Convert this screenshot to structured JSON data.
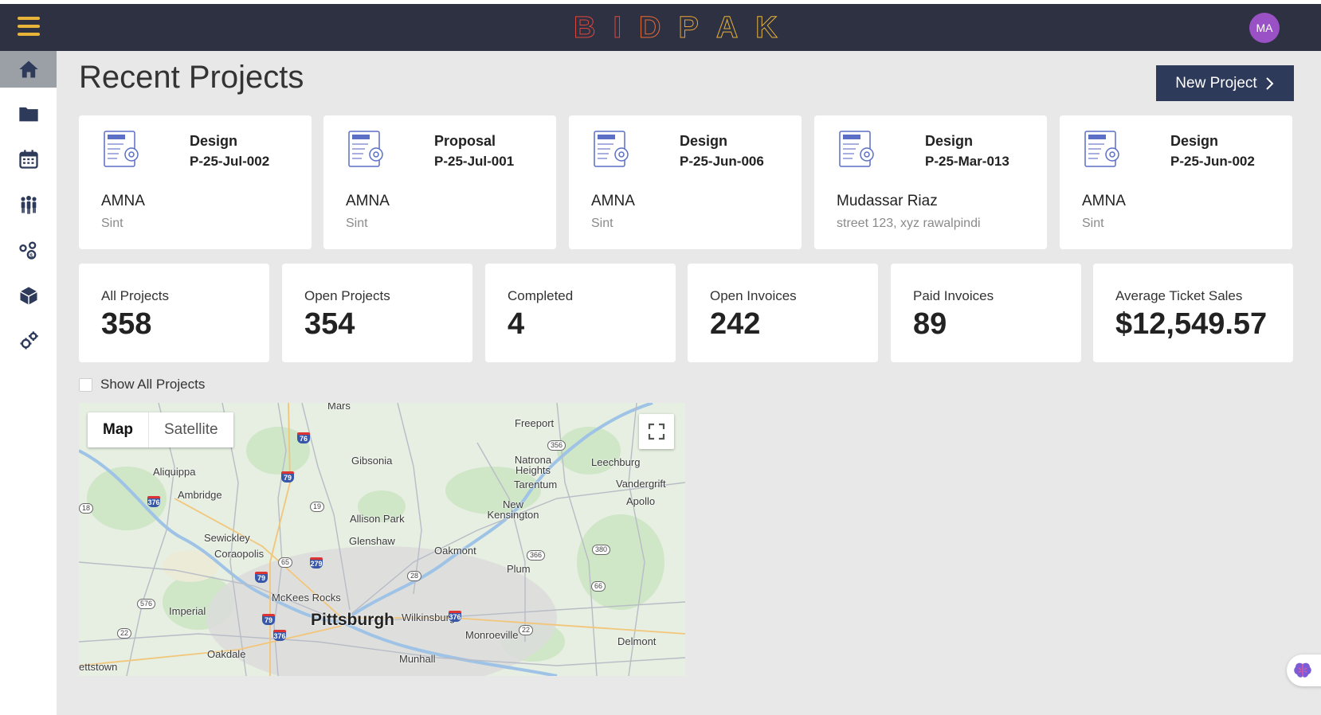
{
  "header": {
    "brand_letters": [
      "B",
      "I",
      "D",
      "P",
      "A",
      "K"
    ],
    "brand_colors": [
      "#e0473c",
      "#e0473c",
      "#e86a35",
      "#e8a437",
      "#e8b339",
      "#e8b339"
    ],
    "accent_color": "#e8b339",
    "avatar_initials": "MA",
    "avatar_color": "#9b51c6",
    "menu_icon": "hamburger-icon"
  },
  "sidebar": {
    "items": [
      {
        "name": "home",
        "icon": "home-icon",
        "active": true
      },
      {
        "name": "projects",
        "icon": "folder-icon",
        "active": false
      },
      {
        "name": "calendar",
        "icon": "calendar-icon",
        "active": false
      },
      {
        "name": "team",
        "icon": "people-icon",
        "active": false
      },
      {
        "name": "finance",
        "icon": "money-cog-icon",
        "active": false
      },
      {
        "name": "products",
        "icon": "box-icon",
        "active": false
      },
      {
        "name": "settings",
        "icon": "gears-icon",
        "active": false
      }
    ]
  },
  "main": {
    "title": "Recent Projects",
    "new_project_label": "New Project",
    "projects": [
      {
        "type": "Design",
        "code": "P-25-Jul-002",
        "client": "AMNA",
        "address": "Sint"
      },
      {
        "type": "Proposal",
        "code": "P-25-Jul-001",
        "client": "AMNA",
        "address": "Sint"
      },
      {
        "type": "Design",
        "code": "P-25-Jun-006",
        "client": "AMNA",
        "address": "Sint"
      },
      {
        "type": "Design",
        "code": "P-25-Mar-013",
        "client": "Mudassar Riaz",
        "address": "street 123, xyz rawalpindi"
      },
      {
        "type": "Design",
        "code": "P-25-Jun-002",
        "client": "AMNA",
        "address": "Sint"
      }
    ],
    "stats": [
      {
        "label": "All Projects",
        "value": "358"
      },
      {
        "label": "Open Projects",
        "value": "354"
      },
      {
        "label": "Completed",
        "value": "4"
      },
      {
        "label": "Open Invoices",
        "value": "242"
      },
      {
        "label": "Paid Invoices",
        "value": "89"
      },
      {
        "label": "Average Ticket Sales",
        "value": "$12,549.57"
      }
    ],
    "show_all_label": "Show All Projects",
    "show_all_checked": false
  },
  "map": {
    "type_active": "Map",
    "type_inactive": "Satellite",
    "city": "Pittsburgh",
    "places": [
      "Mars",
      "Freeport",
      "Gibsonia",
      "Aliquippa",
      "Natrona Heights",
      "Leechburg",
      "Tarentum",
      "Vandergrift",
      "Ambridge",
      "Apollo",
      "New Kensington",
      "Allison Park",
      "Sewickley",
      "Glenshaw",
      "Coraopolis",
      "Oakmont",
      "Plum",
      "McKees Rocks",
      "Imperial",
      "Wilkinsburg",
      "Monroeville",
      "Delmont",
      "Oakdale",
      "Munhall",
      "ettstown"
    ],
    "routes": [
      "76",
      "79",
      "376",
      "19",
      "356",
      "279",
      "65",
      "28",
      "366",
      "380",
      "66",
      "576",
      "22",
      "18"
    ]
  }
}
